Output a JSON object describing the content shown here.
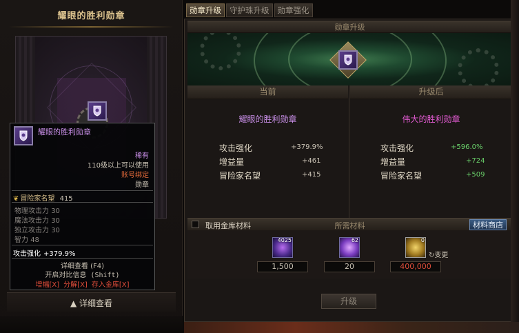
{
  "left": {
    "title": "耀眼的胜利勋章",
    "detail_button": "详细查看"
  },
  "tooltip": {
    "name": "耀眼的胜利勋章",
    "rarity": "稀有",
    "requirement": "110级以上可以使用",
    "binding": "账号绑定",
    "item_type": "勋章",
    "reputation_label": "冒险家名望",
    "reputation_value": "415",
    "stats": [
      {
        "label": "物理攻击力",
        "value": "30"
      },
      {
        "label": "魔法攻击力",
        "value": "30"
      },
      {
        "label": "独立攻击力",
        "value": "30"
      },
      {
        "label": "智力",
        "value": "48"
      }
    ],
    "boost_label": "攻击强化",
    "boost_value": "+379.9%",
    "detail_hint": "详细查看 (F4)",
    "compare_hint": "开启对比信息 (Shift)",
    "actions": [
      "增幅[X]",
      "分解[X]",
      "存入金库[X]"
    ]
  },
  "tabs": [
    {
      "label": "勋章升级",
      "active": true
    },
    {
      "label": "守护珠升级",
      "active": false
    },
    {
      "label": "勋章强化",
      "active": false
    }
  ],
  "upgrade": {
    "section_title": "勋章升级",
    "current": {
      "header": "当前",
      "name": "耀眼的胜利勋章",
      "name_color": "#c98fe8",
      "rows": [
        {
          "label": "攻击强化",
          "value": "+379.9%"
        },
        {
          "label": "增益量",
          "value": "+461"
        },
        {
          "label": "冒险家名望",
          "value": "+415"
        }
      ]
    },
    "after": {
      "header": "升级后",
      "name": "伟大的胜利勋章",
      "name_color": "#e05ad0",
      "value_color": "#6ad06a",
      "rows": [
        {
          "label": "攻击强化",
          "value": "+596.0%"
        },
        {
          "label": "增益量",
          "value": "+724"
        },
        {
          "label": "冒险家名望",
          "value": "+509"
        }
      ]
    }
  },
  "materials": {
    "use_vault_label": "取用金库材料",
    "use_vault_checked": false,
    "title": "所需材料",
    "shop_button": "材料商店",
    "items": [
      {
        "icon": "crystal-cluster-icon",
        "stack_count": "4025",
        "required": "1,500",
        "required_color": "#c9c2b4"
      },
      {
        "icon": "crystal-orb-icon",
        "stack_count": "62",
        "required": "20",
        "required_color": "#c9c2b4"
      },
      {
        "icon": "gold-coins-icon",
        "stack_count": "0",
        "required": "400,000",
        "required_color": "#e04d3a"
      }
    ],
    "change_label": "变更"
  },
  "upgrade_button": "升级"
}
